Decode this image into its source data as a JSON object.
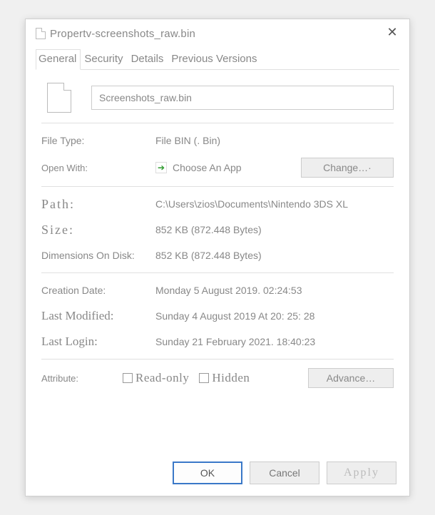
{
  "window": {
    "title": "Propertv-screenshots_raw.bin"
  },
  "tabs": {
    "items": [
      {
        "label": "General",
        "active": true
      },
      {
        "label": "Security",
        "active": false
      },
      {
        "label": "Details",
        "active": false
      },
      {
        "label": "Previous Versions",
        "active": false
      }
    ]
  },
  "general": {
    "filename": "Screenshots_raw.bin",
    "filetype_label": "File Type:",
    "filetype_value": "File BIN (. Bin)",
    "openwith_label": "Open With:",
    "openwith_value": "Choose An App",
    "change_button": "Change…·",
    "path_label": "Path:",
    "path_value": "C:\\Users\\zios\\Documents\\Nintendo 3DS XL",
    "size_label": "Size:",
    "size_value": "852 KB (872.448 Bytes)",
    "sizedisk_label": "Dimensions On Disk:",
    "sizedisk_value": "852 KB (872.448 Bytes)",
    "creation_label": "Creation Date:",
    "creation_value": "Monday 5 August 2019. 02:24:53",
    "modified_label": "Last Modified:",
    "modified_value": "Sunday 4 August 2019 At 20: 25: 28",
    "login_label": "Last Login:",
    "login_value": "Sunday 21 February 2021. 18:40:23",
    "attribute_label": "Attribute:",
    "readonly_label": "Read-only",
    "hidden_label": "Hidden",
    "advanced_button": "Advance…"
  },
  "footer": {
    "ok": "OK",
    "cancel": "Cancel",
    "apply": "Apply"
  }
}
